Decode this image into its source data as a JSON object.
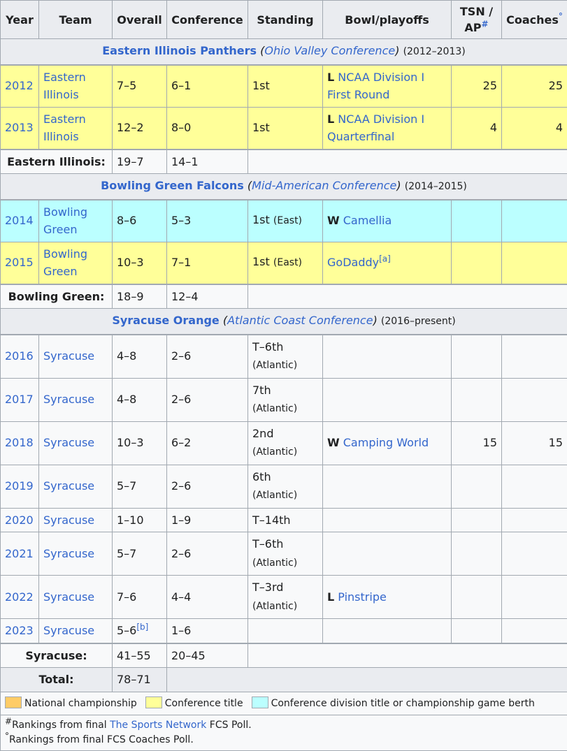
{
  "headers": {
    "year": "Year",
    "team": "Team",
    "overall": "Overall",
    "conference": "Conference",
    "standing": "Standing",
    "bowl": "Bowl/playoffs",
    "tsn_line1": "TSN /",
    "tsn_line2": "AP",
    "tsn_mark": "#",
    "coaches": "Coaches",
    "coaches_mark": "°"
  },
  "sections": [
    {
      "team": "Eastern Illinois Panthers",
      "open_paren": "(",
      "conference": "Ohio Valley Conference",
      "close_paren": ")",
      "years": "(2012–2013)",
      "rows": [
        {
          "year": "2012",
          "team": "Eastern Illinois",
          "overall": "7–5",
          "conf": "6–1",
          "standing": "1st",
          "standing_sub": "",
          "bowl_result": "L",
          "bowl": "NCAA Division I First Round",
          "bowl_note": "",
          "tsn": "25",
          "coaches": "25",
          "color": "#ffff99"
        },
        {
          "year": "2013",
          "team": "Eastern Illinois",
          "overall": "12–2",
          "conf": "8–0",
          "standing": "1st",
          "standing_sub": "",
          "bowl_result": "L",
          "bowl": "NCAA Division I Quarterfinal",
          "bowl_note": "",
          "tsn": "4",
          "coaches": "4",
          "color": "#ffff99"
        }
      ],
      "subtotal_label": "Eastern Illinois:",
      "subtotal_overall": "19–7",
      "subtotal_conf": "14–1"
    },
    {
      "team": "Bowling Green Falcons",
      "open_paren": "(",
      "conference": "Mid-American Conference",
      "close_paren": ")",
      "years": "(2014–2015)",
      "rows": [
        {
          "year": "2014",
          "team": "Bowling Green",
          "overall": "8–6",
          "conf": "5–3",
          "standing": "1st",
          "standing_sub": "(East)",
          "bowl_result": "W",
          "bowl": "Camellia",
          "bowl_note": "",
          "tsn": "",
          "coaches": "",
          "color": "#bbffff"
        },
        {
          "year": "2015",
          "team": "Bowling Green",
          "overall": "10–3",
          "conf": "7–1",
          "standing": "1st",
          "standing_sub": "(East)",
          "bowl_result": "",
          "bowl": "GoDaddy",
          "bowl_note": "[a]",
          "tsn": "",
          "coaches": "",
          "color": "#ffff99"
        }
      ],
      "subtotal_label": "Bowling Green:",
      "subtotal_overall": "18–9",
      "subtotal_conf": "12–4"
    },
    {
      "team": "Syracuse Orange",
      "open_paren": "(",
      "conference": "Atlantic Coast Conference",
      "close_paren": ")",
      "years": "(2016–present)",
      "rows": [
        {
          "year": "2016",
          "team": "Syracuse",
          "overall": "4–8",
          "overall_note": "",
          "conf": "2–6",
          "standing": "T–6th",
          "standing_sub": "(Atlantic)",
          "bowl_result": "",
          "bowl": "",
          "tsn": "",
          "coaches": ""
        },
        {
          "year": "2017",
          "team": "Syracuse",
          "overall": "4–8",
          "overall_note": "",
          "conf": "2–6",
          "standing": "7th",
          "standing_sub": "(Atlantic)",
          "bowl_result": "",
          "bowl": "",
          "tsn": "",
          "coaches": ""
        },
        {
          "year": "2018",
          "team": "Syracuse",
          "overall": "10–3",
          "overall_note": "",
          "conf": "6–2",
          "standing": "2nd",
          "standing_sub": "(Atlantic)",
          "bowl_result": "W",
          "bowl": "Camping World",
          "tsn": "15",
          "coaches": "15"
        },
        {
          "year": "2019",
          "team": "Syracuse",
          "overall": "5–7",
          "overall_note": "",
          "conf": "2–6",
          "standing": "6th",
          "standing_sub": "(Atlantic)",
          "bowl_result": "",
          "bowl": "",
          "tsn": "",
          "coaches": ""
        },
        {
          "year": "2020",
          "team": "Syracuse",
          "overall": "1–10",
          "overall_note": "",
          "conf": "1–9",
          "standing": "T–14th",
          "standing_sub": "",
          "bowl_result": "",
          "bowl": "",
          "tsn": "",
          "coaches": ""
        },
        {
          "year": "2021",
          "team": "Syracuse",
          "overall": "5–7",
          "overall_note": "",
          "conf": "2–6",
          "standing": "T–6th",
          "standing_sub": "(Atlantic)",
          "bowl_result": "",
          "bowl": "",
          "tsn": "",
          "coaches": ""
        },
        {
          "year": "2022",
          "team": "Syracuse",
          "overall": "7–6",
          "overall_note": "",
          "conf": "4–4",
          "standing": "T–3rd",
          "standing_sub": "(Atlantic)",
          "bowl_result": "L",
          "bowl": "Pinstripe",
          "tsn": "",
          "coaches": ""
        },
        {
          "year": "2023",
          "team": "Syracuse",
          "overall": "5–6",
          "overall_note": "[b]",
          "conf": "1–6",
          "standing": "",
          "standing_sub": "",
          "bowl_result": "",
          "bowl": "",
          "tsn": "",
          "coaches": ""
        }
      ],
      "subtotal_label": "Syracuse:",
      "subtotal_overall": "41–55",
      "subtotal_conf": "20–45"
    }
  ],
  "total": {
    "label": "Total:",
    "overall": "78–71"
  },
  "legend": [
    {
      "label": "National championship",
      "color": "#ffcc66"
    },
    {
      "label": "Conference title",
      "color": "#ffff99"
    },
    {
      "label": "Conference division title or championship game berth",
      "color": "#bbffff"
    }
  ],
  "notes": {
    "note1_mark": "#",
    "note1_pre": "Rankings from final ",
    "note1_link": "The Sports Network",
    "note1_post": " FCS Poll.",
    "note2_mark": "°",
    "note2_text": "Rankings from final FCS Coaches Poll."
  }
}
